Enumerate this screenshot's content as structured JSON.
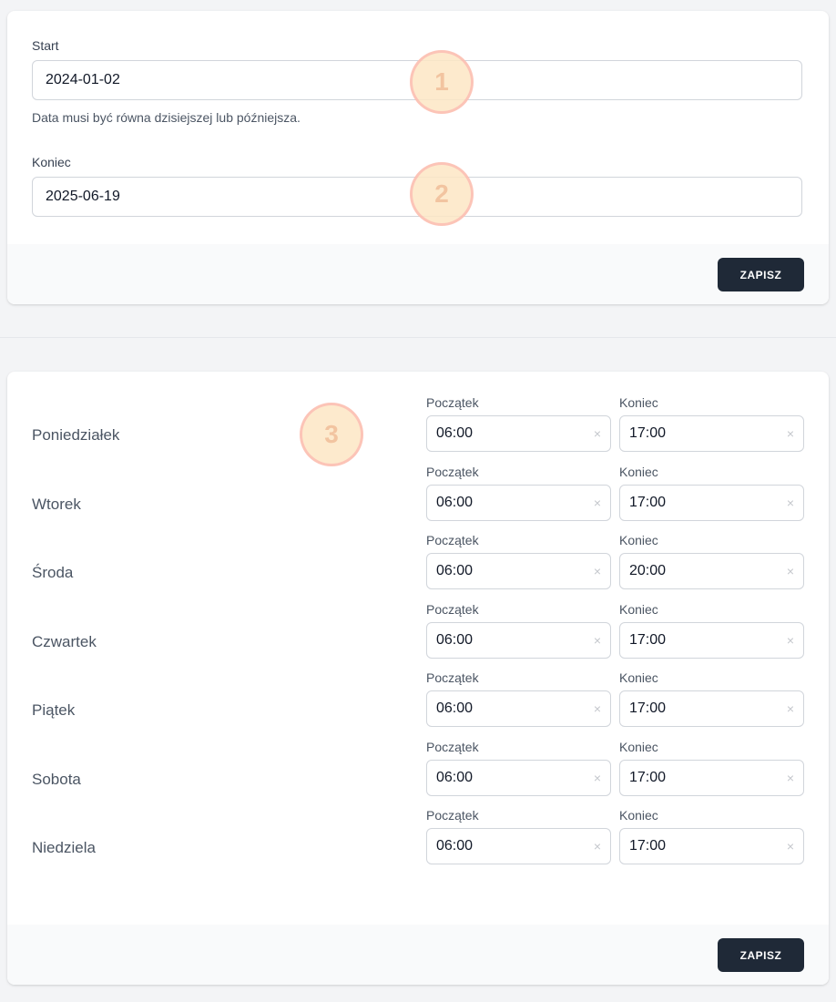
{
  "dates_form": {
    "start_label": "Start",
    "start_value": "2024-01-02",
    "start_hint": "Data musi być równa dzisiejszej lub późniejsza.",
    "end_label": "Koniec",
    "end_value": "2025-06-19",
    "save_label": "ZAPISZ"
  },
  "badges": [
    "1",
    "2",
    "3"
  ],
  "hours_form": {
    "start_col_label": "Początek",
    "end_col_label": "Koniec",
    "clear_glyph": "×",
    "save_label": "ZAPISZ",
    "days": [
      {
        "name": "Poniedziałek",
        "start": "06:00",
        "end": "17:00"
      },
      {
        "name": "Wtorek",
        "start": "06:00",
        "end": "17:00"
      },
      {
        "name": "Środa",
        "start": "06:00",
        "end": "20:00"
      },
      {
        "name": "Czwartek",
        "start": "06:00",
        "end": "17:00"
      },
      {
        "name": "Piątek",
        "start": "06:00",
        "end": "17:00"
      },
      {
        "name": "Sobota",
        "start": "06:00",
        "end": "17:00"
      },
      {
        "name": "Niedziela",
        "start": "06:00",
        "end": "17:00"
      }
    ]
  },
  "colors": {
    "button_bg": "#1f2937",
    "page_bg": "#f3f4f6",
    "badge_fill": "#fde6c4"
  }
}
